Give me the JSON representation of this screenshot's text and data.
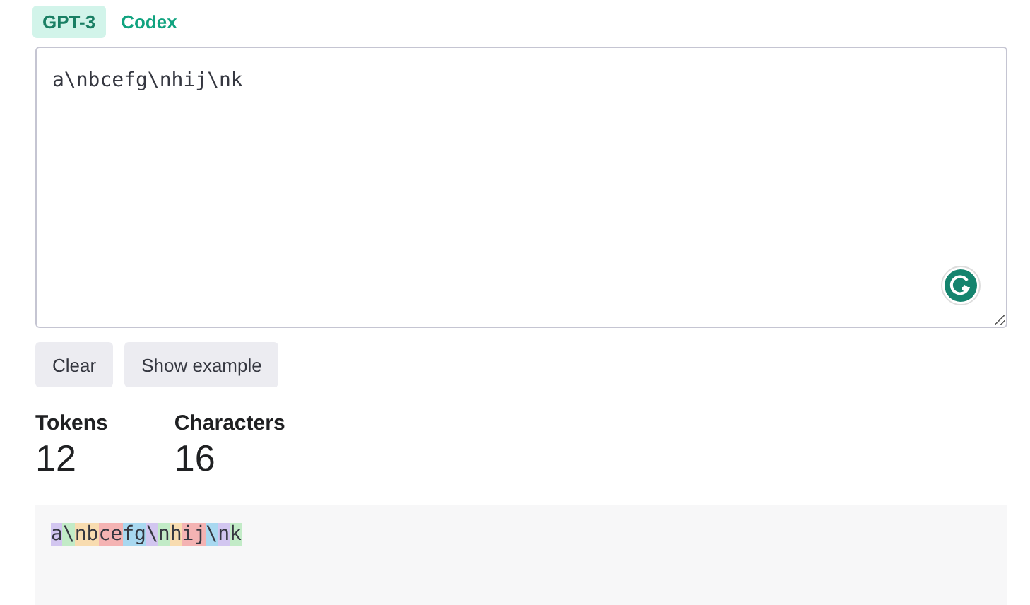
{
  "tabs": [
    {
      "label": "GPT-3",
      "selected": true
    },
    {
      "label": "Codex",
      "selected": false
    }
  ],
  "input": {
    "value": "a\\nbcefg\\nhij\\nk"
  },
  "buttons": [
    "Clear",
    "Show example"
  ],
  "stats": [
    {
      "label": "Tokens",
      "value": "12"
    },
    {
      "label": "Characters",
      "value": "16"
    }
  ],
  "tokens": [
    {
      "text": "a",
      "color": "#d2c6f0"
    },
    {
      "text": "\\",
      "color": "#c2ebc7"
    },
    {
      "text": "nb",
      "color": "#f8dcb0"
    },
    {
      "text": "ce",
      "color": "#f4b3b3"
    },
    {
      "text": "fg",
      "color": "#a8d8f0"
    },
    {
      "text": "\\",
      "color": "#d2c6f0"
    },
    {
      "text": "n",
      "color": "#c2ebc7"
    },
    {
      "text": "h",
      "color": "#f8dcb0"
    },
    {
      "text": "ij",
      "color": "#f4b3b3"
    },
    {
      "text": "\\",
      "color": "#a8d8f0"
    },
    {
      "text": "n",
      "color": "#d2c6f0"
    },
    {
      "text": "k",
      "color": "#c2ebc7"
    }
  ]
}
